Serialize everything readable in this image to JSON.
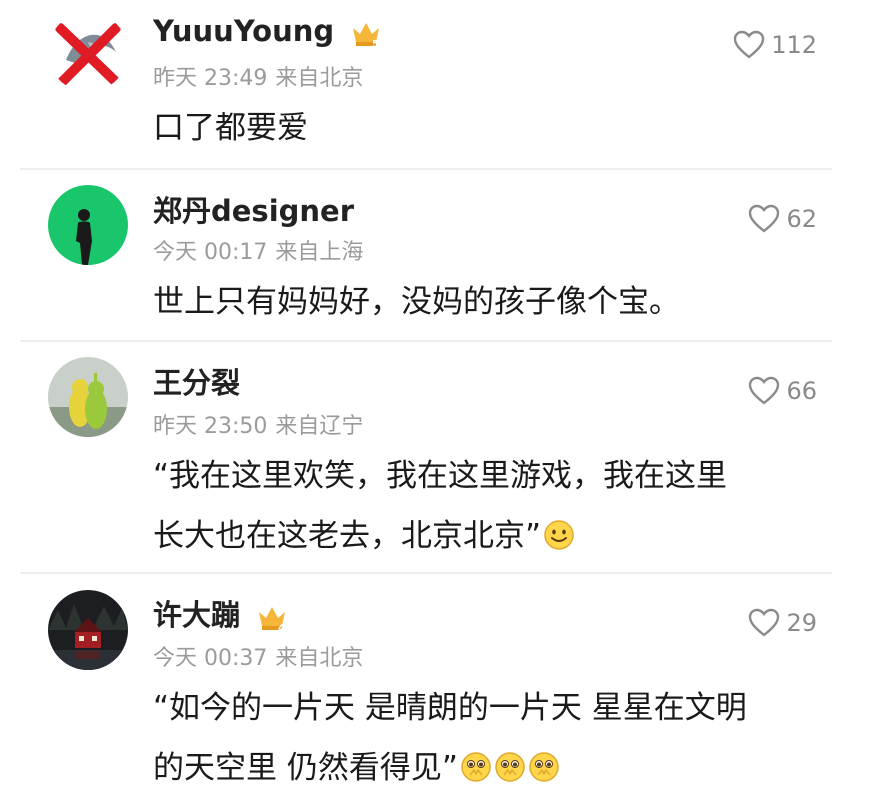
{
  "comments": [
    {
      "user": "YuuuYoung",
      "crown_level": "5",
      "time": "昨天 23:49",
      "location": "来自北京",
      "likes": "112",
      "lines": [
        "口了都要爱"
      ],
      "avatar": "crossed-out-avatar"
    },
    {
      "user": "郑丹designer",
      "time": "今天 00:17",
      "location": "来自上海",
      "likes": "62",
      "lines": [
        "世上只有妈妈好，没妈的孩子像个宝。"
      ],
      "avatar": "green-silhouette-avatar"
    },
    {
      "user": "王分裂",
      "time": "昨天 23:50",
      "location": "来自辽宁",
      "likes": "66",
      "lines": [
        "“我在这里欢笑，我在这里游戏，我在这里",
        "长大也在这老去，北京北京”"
      ],
      "avatar": "teletubbies-avatar"
    },
    {
      "user": "许大蹦",
      "crown_level": "4",
      "time": "今天 00:37",
      "location": "来自北京",
      "likes": "29",
      "lines": [
        "“如今的一片天 是晴朗的一片天 星星在文明",
        "的天空里 仍然看得见”"
      ],
      "avatar": "red-house-avatar"
    }
  ],
  "colors": {
    "meta": "#9b9b9b",
    "like": "#8a8a8a",
    "crown": "#f5b63a"
  },
  "icons": {
    "like": "heart-outline-icon",
    "crown": "crown-icon",
    "smile": "smile-emoji",
    "pleading": "pleading-emoji"
  }
}
